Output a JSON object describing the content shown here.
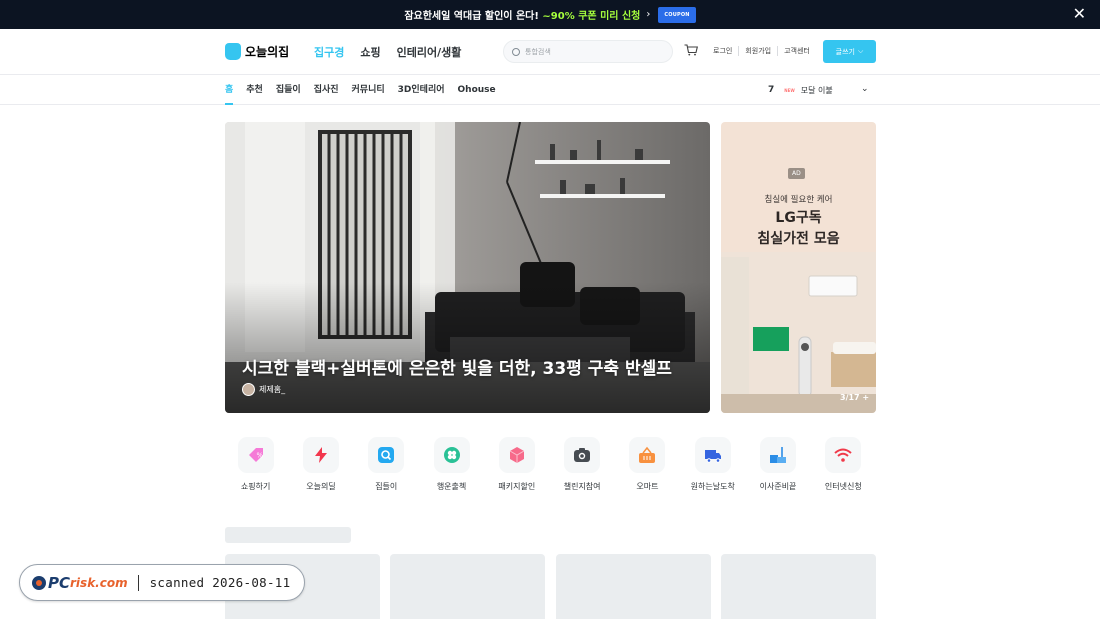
{
  "banner": {
    "prefix": "잠요한세일 역대급 할인이 온다! ",
    "highlight": "~90% 쿠폰 미리 신청",
    "coupon_label": "COUPON",
    "close_icon": "close-icon"
  },
  "header": {
    "logo_text": "오늘의집",
    "nav": [
      "집구경",
      "쇼핑",
      "인테리어/생활"
    ],
    "search_placeholder": "통합검색",
    "util": [
      "로그인",
      "회원가입",
      "고객센터"
    ],
    "write_label": "글쓰기",
    "accent": "#35c5f0"
  },
  "subnav": {
    "tabs": [
      "홈",
      "추천",
      "집들이",
      "집사진",
      "커뮤니티",
      "3D인테리어",
      "Ohouse"
    ],
    "rank_num": "7",
    "rank_new": "NEW",
    "rank_text": "모달 이불"
  },
  "hero": {
    "title": "시크한 블랙+실버톤에 은은한 빛을 더한, 33평 구축 반셀프",
    "author": "제제홈_"
  },
  "ad": {
    "badge": "AD",
    "line1": "침실에 필요한 케어",
    "line2": "LG구독",
    "line3": "침실가전 모음",
    "pager": "3/17",
    "plus": "+"
  },
  "categories": [
    {
      "label": "쇼핑하기",
      "icon": "shopping-tag-icon",
      "color": "#f57ad7"
    },
    {
      "label": "오늘의딜",
      "icon": "lightning-icon",
      "color": "#f2374d"
    },
    {
      "label": "집들이",
      "icon": "house-search-icon",
      "color": "#24a9f0"
    },
    {
      "label": "행운출첵",
      "icon": "clover-icon",
      "color": "#2ac196"
    },
    {
      "label": "패키지할인",
      "icon": "package-box-icon",
      "color": "#f76a8a"
    },
    {
      "label": "챌린지참여",
      "icon": "camera-icon",
      "color": "#474c52"
    },
    {
      "label": "오마트",
      "icon": "basket-icon",
      "color": "#f8913f"
    },
    {
      "label": "원하는날도착",
      "icon": "delivery-truck-icon",
      "color": "#3565e0"
    },
    {
      "label": "이사준비끝",
      "icon": "moving-icon",
      "color": "#2b8de6"
    },
    {
      "label": "인터넷신청",
      "icon": "wifi-icon",
      "color": "#f03a4a"
    }
  ],
  "watermark": {
    "brand_pc": "PC",
    "brand_risk": "risk.com",
    "text": "scanned 2026-08-11"
  }
}
